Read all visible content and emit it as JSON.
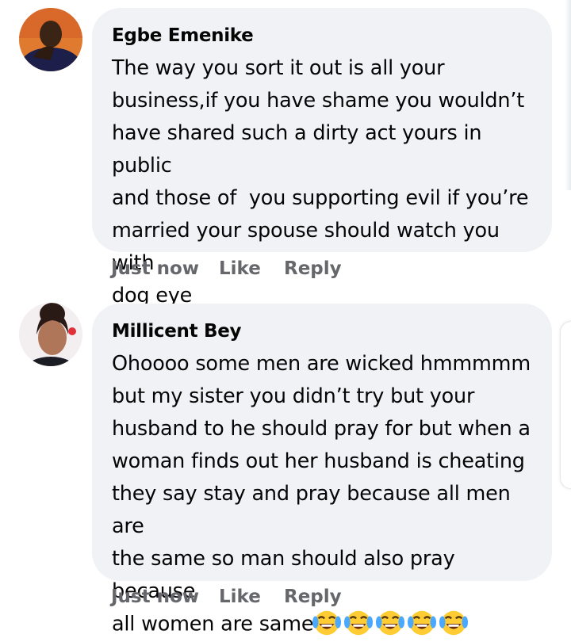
{
  "comments": [
    {
      "author": "Egbe Emenike",
      "text": "The way you sort it out is all your\nbusiness,if you have shame you wouldn’t\nhave shared such a dirty act yours in public\nand those of  you supporting evil if you’re\nmarried your spouse should watch you with\ndog eye",
      "time": "Just now",
      "like": "Like",
      "reply": "Reply"
    },
    {
      "author": "Millicent Bey",
      "text": "Ohoooo some men are wicked hmmmmm\nbut my sister you didn’t try but your\nhusband to he should pray for but when a\nwoman finds out her husband is cheating\nthey say stay and pray because all men are\nthe same so man should also pray because\nall women are same",
      "emoji": [
        "face-with-tears-of-joy",
        "face-with-tears-of-joy",
        "face-with-tears-of-joy",
        "face-with-tears-of-joy",
        "face-with-tears-of-joy"
      ],
      "time": "Just now",
      "like": "Like",
      "reply": "Reply"
    }
  ]
}
